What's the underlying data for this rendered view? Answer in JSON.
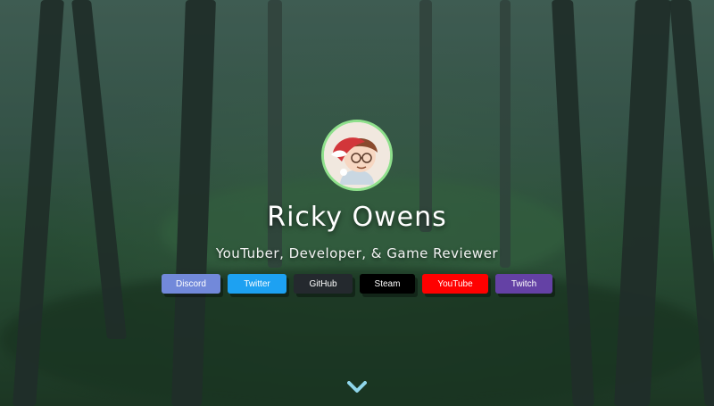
{
  "profile": {
    "name": "Ricky Owens",
    "tagline": "YouTuber, Developer, & Game Reviewer",
    "avatar_icon": "avatar-christmas-character"
  },
  "links": [
    {
      "label": "Discord",
      "color": "#7289da"
    },
    {
      "label": "Twitter",
      "color": "#1da1f2"
    },
    {
      "label": "GitHub",
      "color": "#24292e"
    },
    {
      "label": "Steam",
      "color": "#000000"
    },
    {
      "label": "YouTube",
      "color": "#ff0000"
    },
    {
      "label": "Twitch",
      "color": "#6441a5"
    }
  ],
  "scroll_indicator": {
    "icon": "chevron-down-icon",
    "color": "#8fd6ea"
  },
  "theme": {
    "avatar_border": "#8fe08c"
  }
}
